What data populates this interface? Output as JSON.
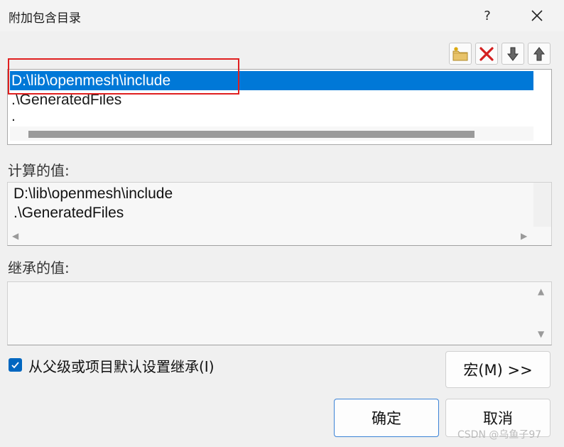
{
  "window": {
    "title": "附加包含目录",
    "help_label": "?",
    "close_label": "✕"
  },
  "toolbar": {
    "new_folder_icon": "new-folder-icon",
    "delete_icon": "delete-icon",
    "move_down_icon": "move-down-icon",
    "move_up_icon": "move-up-icon"
  },
  "list": {
    "items": [
      {
        "label": "D:\\lib\\openmesh\\include",
        "selected": true
      },
      {
        "label": ".\\GeneratedFiles",
        "selected": false
      },
      {
        "label": ".",
        "selected": false
      }
    ]
  },
  "computed": {
    "label": "计算的值:",
    "lines": [
      "D:\\lib\\openmesh\\include",
      ".\\GeneratedFiles"
    ]
  },
  "inherited": {
    "label": "继承的值:"
  },
  "inherit_checkbox": {
    "checked": true,
    "label": "从父级或项目默认设置继承(I)"
  },
  "buttons": {
    "macro": "宏(M) >>",
    "ok": "确定",
    "cancel": "取消"
  },
  "watermark": "CSDN @乌鱼子97",
  "colors": {
    "selection": "#0078d7",
    "highlight_box": "#e02020",
    "checkbox": "#0067c0"
  }
}
